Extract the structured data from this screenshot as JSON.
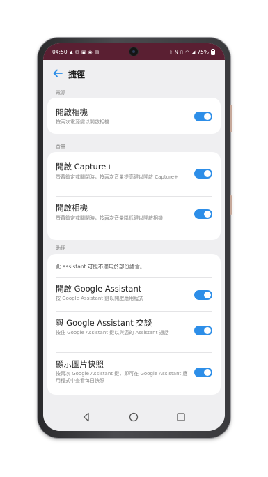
{
  "status_bar": {
    "time": "04:50",
    "left_icons": [
      "warning-icon",
      "mail-icon",
      "voicemail-icon",
      "chat-icon",
      "message-icon"
    ],
    "battery": "75%",
    "right_icons": [
      "bluetooth-icon",
      "nfc-icon",
      "vibrate-icon",
      "wifi-icon",
      "signal-icon",
      "battery-icon"
    ]
  },
  "header": {
    "title": "捷徑"
  },
  "sections": [
    {
      "label": "電源",
      "items": [
        {
          "title": "開啟相機",
          "description": "按兩次電源鍵以開啟相機",
          "enabled": true
        }
      ]
    },
    {
      "label": "音量",
      "items": [
        {
          "title": "開啟 Capture+",
          "description": "螢幕鎖定或關閉時，按兩次音量提高鍵以開啟 Capture+",
          "enabled": true
        },
        {
          "title": "開啟相機",
          "description": "螢幕鎖定或關閉時，按兩次音量降低鍵以開啟相機",
          "enabled": true
        }
      ]
    },
    {
      "label": "助理",
      "note": "此 assistant 可能不適用於部份語言。",
      "items": [
        {
          "title": "開啟 Google Assistant",
          "description": "按 Google Assistant 鍵以開啟應用程式",
          "enabled": true
        },
        {
          "title": "與 Google Assistant 交談",
          "description": "按住 Google Assistant 鍵以與您的 Assistant 通話",
          "enabled": true
        },
        {
          "title": "顯示圖片快照",
          "description": "按兩次 Google Assistant 鍵，即可在 Google Assistant 應用程式中查看每日快照",
          "enabled": true
        }
      ]
    }
  ],
  "nav_bar": {
    "buttons": [
      "back-icon",
      "home-icon",
      "recents-icon"
    ]
  },
  "colors": {
    "accent": "#2d8ee8",
    "status_bar": "#5a1f32",
    "background": "#efeff1"
  }
}
